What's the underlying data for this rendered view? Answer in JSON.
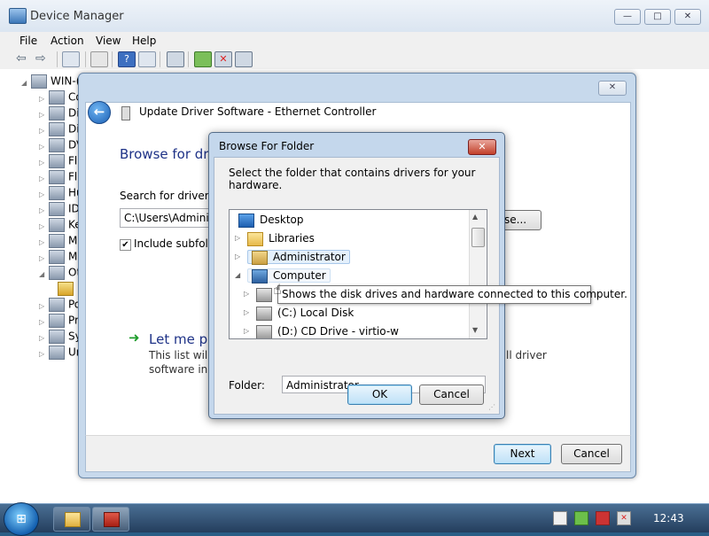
{
  "device_manager": {
    "title": "Device Manager",
    "menu": [
      "File",
      "Action",
      "View",
      "Help"
    ],
    "tree_root": "WIN-(",
    "tree_items": [
      "Co",
      "Di",
      "Di",
      "DV",
      "Fl",
      "Fl",
      "Hu",
      "ID",
      "Ke",
      "M",
      "M",
      "Ot",
      "",
      "Po",
      "Pr",
      "Sy",
      "Un"
    ]
  },
  "wizard": {
    "title": "Update Driver Software - Ethernet Controller",
    "heading": "Browse for driv",
    "search_label": "Search for driver so",
    "path_value": "C:\\Users\\Administ",
    "browse_label": "se...",
    "include_subfolders": "Include subfolde",
    "let_me_pick": "Let me pic",
    "pick_desc_line1": "This list will s",
    "pick_desc_line2": "software in th",
    "pick_desc_right": "ll driver",
    "next_label": "Next",
    "cancel_label": "Cancel"
  },
  "browse_dialog": {
    "title": "Browse For Folder",
    "instruction": "Select the folder that contains drivers for your hardware.",
    "tree": [
      {
        "label": "Desktop",
        "icon": "desktop-icon"
      },
      {
        "label": "Libraries",
        "icon": "folder-icon"
      },
      {
        "label": "Administrator",
        "icon": "user-folder-icon"
      },
      {
        "label": "Computer",
        "icon": "computer-icon"
      },
      {
        "label": "",
        "icon": "drive-icon"
      },
      {
        "label": "(C:) Local Disk",
        "icon": "local-disk-icon"
      },
      {
        "label": "(D:) CD Drive - virtio-w",
        "icon": "cd-drive-icon"
      }
    ],
    "tooltip": "Shows the disk drives and hardware connected to this computer.",
    "folder_label": "Folder:",
    "folder_value": "Administrator",
    "ok_label": "OK",
    "cancel_label": "Cancel"
  },
  "taskbar": {
    "clock": "12:43"
  }
}
